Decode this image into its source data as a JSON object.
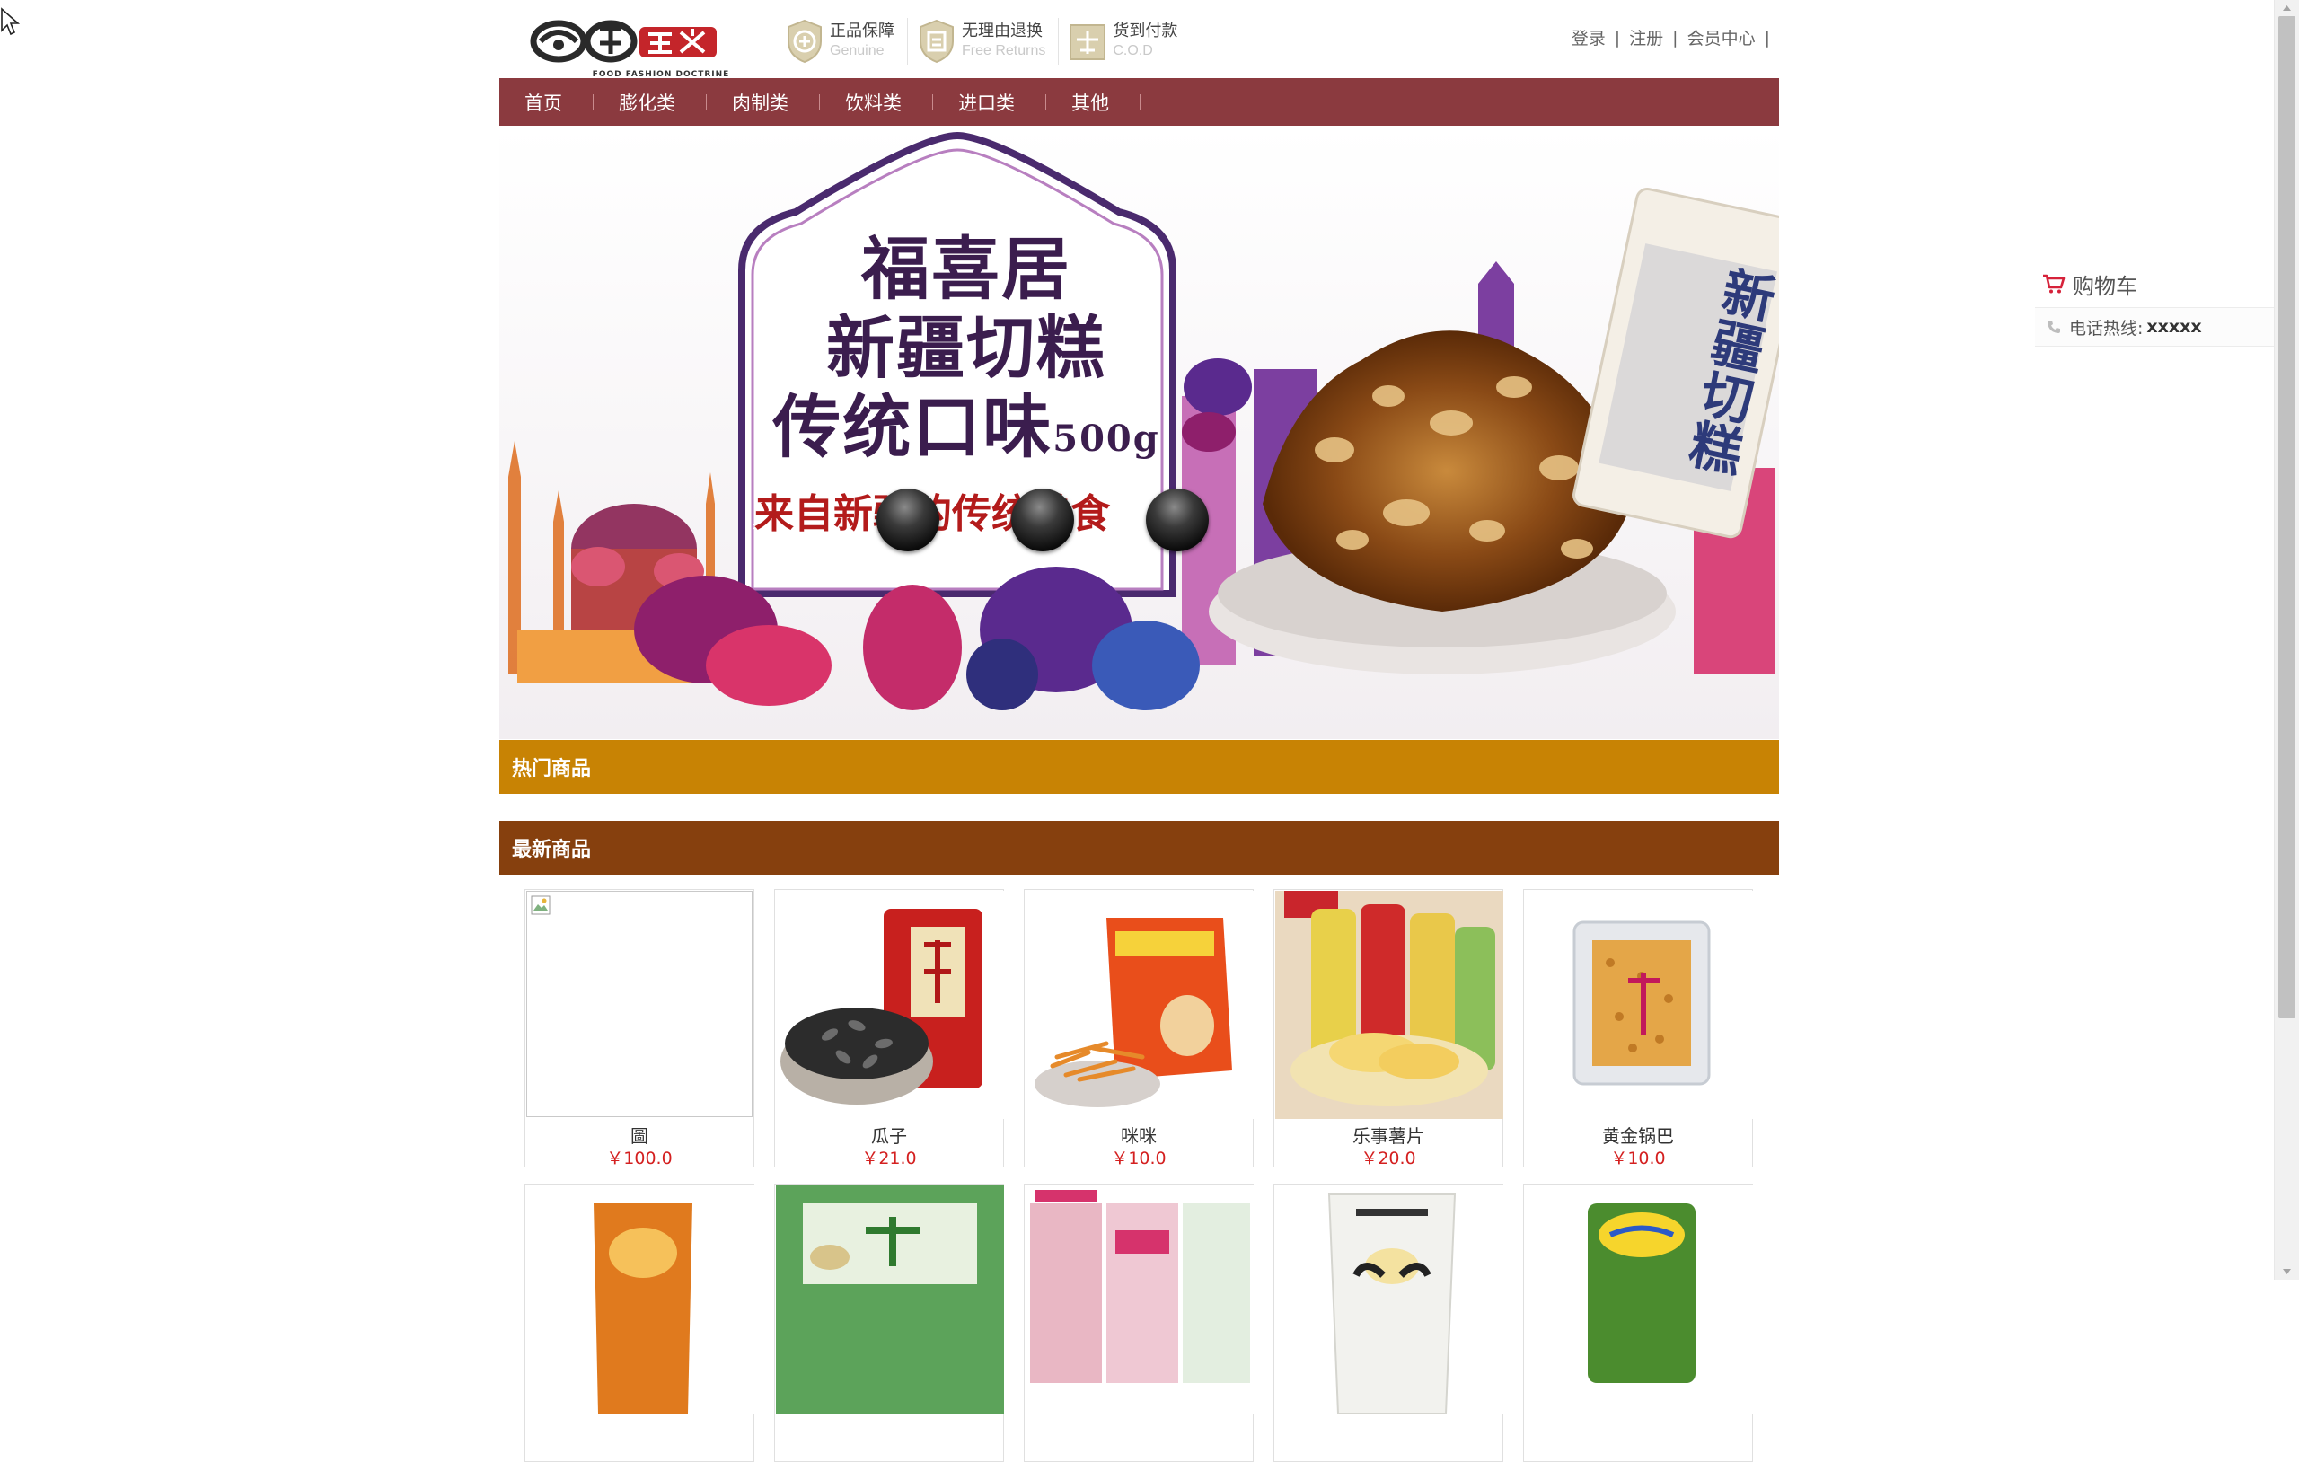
{
  "header": {
    "logo_caption": "FOOD FASHION DOCTRINE",
    "badges": [
      {
        "title": "正品保障",
        "subtitle": "Genuine",
        "icon": "genuine-shield-icon"
      },
      {
        "title": "无理由退换",
        "subtitle": "Free Returns",
        "icon": "return-shield-icon"
      },
      {
        "title": "货到付款",
        "subtitle": "C.O.D",
        "icon": "cod-box-icon"
      }
    ],
    "user_links": {
      "login": "登录",
      "register": "注册",
      "member": "会员中心",
      "sep": "|"
    }
  },
  "nav": {
    "items": [
      "首页",
      "膨化类",
      "肉制类",
      "饮料类",
      "进口类",
      "其他"
    ]
  },
  "banner": {
    "lines": [
      "福喜居",
      "新疆切糕",
      "传统口味"
    ],
    "weight": "500g",
    "slogan": "来自新疆的传统美食",
    "package_text": "新疆切糕",
    "slide_count": 3
  },
  "sections": {
    "hot": "热门商品",
    "newest": "最新商品"
  },
  "products": [
    {
      "name": "圖",
      "price": "￥100.0",
      "image": "broken"
    },
    {
      "name": "瓜子",
      "price": "￥21.0",
      "image": "sunflower-seeds"
    },
    {
      "name": "咪咪",
      "price": "￥10.0",
      "image": "mimi-snack"
    },
    {
      "name": "乐事薯片",
      "price": "￥20.0",
      "image": "lays-chips"
    },
    {
      "name": "黄金锅巴",
      "price": "￥10.0",
      "image": "golden-crispy-rice"
    },
    {
      "name": "",
      "price": "",
      "image": "orange-snack-bag"
    },
    {
      "name": "",
      "price": "",
      "image": "pistachio-bag"
    },
    {
      "name": "",
      "price": "",
      "image": "rice-puffs"
    },
    {
      "name": "",
      "price": "",
      "image": "dog-food-bag"
    },
    {
      "name": "",
      "price": "",
      "image": "chicky-chic"
    }
  ],
  "side_panel": {
    "cart_label": "购物车",
    "phone_label": "电话热线:",
    "phone_number": "xxxxx"
  },
  "colors": {
    "nav_bg": "#8b3a3f",
    "hot_bar": "#c88304",
    "new_bar": "#86400e",
    "price": "#d42020"
  }
}
